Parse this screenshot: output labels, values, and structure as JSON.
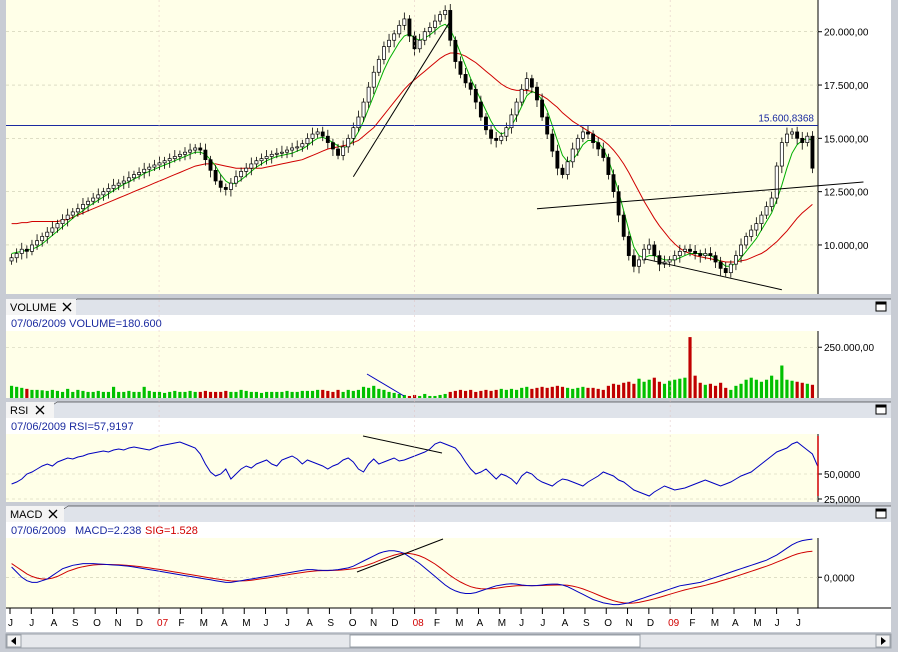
{
  "colors": {
    "bg": "#ffffe8",
    "frame": "#c8ccd4",
    "up": "#ffffff",
    "down": "#000000",
    "sma_fast": "#00b000",
    "sma_slow": "#d00000",
    "trend": "#0000c0",
    "vol_up": "#00c000",
    "vol_down": "#c00000",
    "rsi": "#0000c0",
    "macd": "#0000c0",
    "sig": "#d00000"
  },
  "icons": {
    "panel_close": "close-icon",
    "panel_max": "maximize-icon",
    "scroll_left": "arrow-left-icon",
    "scroll_right": "arrow-right-icon"
  },
  "chart_data": [
    {
      "type": "candlestick",
      "title": "",
      "y_ticks": [
        "20.000,00",
        "17.500,00",
        "15.000,00",
        "12.500,00",
        "10.000,00"
      ],
      "ylim": [
        7700,
        21300
      ],
      "hline_label": "15.600,8368",
      "hline_value": 15600.8368,
      "closes": [
        9400,
        9600,
        9800,
        9700,
        10000,
        10200,
        10400,
        10600,
        10800,
        11000,
        11200,
        11400,
        11550,
        11700,
        11900,
        12050,
        12200,
        12350,
        12500,
        12650,
        12800,
        12900,
        13000,
        13150,
        13300,
        13400,
        13550,
        13650,
        13750,
        13850,
        13950,
        14050,
        14150,
        14250,
        14350,
        14450,
        14550,
        14450,
        14000,
        13500,
        13000,
        12700,
        12600,
        12900,
        13200,
        13450,
        13600,
        13800,
        13950,
        14050,
        14150,
        14250,
        14300,
        14350,
        14450,
        14550,
        14600,
        14750,
        15000,
        15200,
        15300,
        15100,
        14800,
        14500,
        14200,
        14600,
        15000,
        15500,
        16000,
        16700,
        17400,
        18100,
        18700,
        19300,
        19600,
        19900,
        20300,
        20600,
        19800,
        19200,
        19600,
        20000,
        20200,
        20500,
        20800,
        21000,
        19600,
        18600,
        18000,
        17600,
        17300,
        16700,
        16000,
        15400,
        15000,
        14900,
        15100,
        15500,
        16100,
        16700,
        17300,
        17800,
        17400,
        16800,
        16000,
        15200,
        14400,
        13600,
        13300,
        13900,
        14500,
        15000,
        15300,
        15200,
        14800,
        14500,
        14100,
        13300,
        12500,
        11400,
        10400,
        9500,
        9000,
        9300,
        9800,
        10000,
        9500,
        9100,
        9200,
        9300,
        9500,
        9700,
        9800,
        9700,
        9600,
        9500,
        9600,
        9500,
        9200,
        8900,
        8700,
        9100,
        9500,
        10000,
        10400,
        10700,
        11000,
        11400,
        11800,
        12200,
        13700,
        14800,
        15200,
        15300,
        15000,
        14800,
        15100,
        13600
      ],
      "sma_fast": [
        9600,
        9650,
        9700,
        9750,
        9800,
        9900,
        10050,
        10250,
        10450,
        10650,
        10850,
        11050,
        11250,
        11450,
        11600,
        11800,
        11950,
        12100,
        12250,
        12400,
        12550,
        12700,
        12850,
        12950,
        13100,
        13200,
        13350,
        13450,
        13550,
        13650,
        13750,
        13850,
        13950,
        14050,
        14150,
        14250,
        14350,
        14350,
        14250,
        14000,
        13700,
        13300,
        13000,
        12850,
        12900,
        13050,
        13250,
        13450,
        13650,
        13800,
        13950,
        14050,
        14150,
        14200,
        14250,
        14300,
        14400,
        14500,
        14650,
        14850,
        15000,
        15050,
        14950,
        14800,
        14650,
        14550,
        14650,
        14900,
        15300,
        15800,
        16400,
        17000,
        17600,
        18200,
        18700,
        19100,
        19500,
        19800,
        19900,
        19700,
        19600,
        19700,
        19850,
        20050,
        20250,
        20350,
        20100,
        19600,
        19000,
        18400,
        17800,
        17300,
        16800,
        16300,
        15800,
        15400,
        15200,
        15300,
        15600,
        16000,
        16500,
        17000,
        17200,
        17100,
        16800,
        16300,
        15600,
        14900,
        14200,
        13900,
        14000,
        14300,
        14700,
        14900,
        14900,
        14800,
        14500,
        14000,
        13300,
        12500,
        11600,
        10700,
        9900,
        9500,
        9400,
        9500,
        9500,
        9400,
        9300,
        9300,
        9300,
        9400,
        9500,
        9600,
        9600,
        9600,
        9550,
        9500,
        9400,
        9200,
        9000,
        9000,
        9150,
        9400,
        9700,
        10000,
        10300,
        10700,
        11100,
        11500,
        12100,
        12800,
        13600,
        14300,
        14700,
        14900,
        15000,
        14900
      ],
      "sma_slow": [
        11000,
        11000,
        11050,
        11050,
        11100,
        11100,
        11100,
        11100,
        11100,
        11100,
        11150,
        11200,
        11300,
        11400,
        11500,
        11600,
        11700,
        11800,
        11900,
        12000,
        12100,
        12200,
        12300,
        12400,
        12500,
        12600,
        12700,
        12800,
        12900,
        13000,
        13100,
        13200,
        13300,
        13400,
        13500,
        13600,
        13700,
        13750,
        13800,
        13800,
        13800,
        13750,
        13700,
        13650,
        13600,
        13600,
        13600,
        13600,
        13600,
        13600,
        13650,
        13700,
        13750,
        13800,
        13850,
        13900,
        13950,
        14000,
        14100,
        14200,
        14300,
        14400,
        14500,
        14550,
        14600,
        14650,
        14700,
        14800,
        14900,
        15100,
        15300,
        15500,
        15800,
        16100,
        16400,
        16700,
        17000,
        17300,
        17550,
        17750,
        17950,
        18150,
        18350,
        18550,
        18750,
        18900,
        19000,
        19000,
        18950,
        18850,
        18700,
        18550,
        18350,
        18150,
        17950,
        17750,
        17550,
        17400,
        17300,
        17250,
        17250,
        17250,
        17200,
        17100,
        17000,
        16850,
        16650,
        16450,
        16200,
        16000,
        15800,
        15650,
        15500,
        15350,
        15200,
        15050,
        14900,
        14700,
        14450,
        14150,
        13800,
        13400,
        12950,
        12500,
        12050,
        11650,
        11250,
        10900,
        10600,
        10300,
        10050,
        9850,
        9700,
        9600,
        9500,
        9450,
        9400,
        9350,
        9300,
        9250,
        9200,
        9200,
        9200,
        9250,
        9300,
        9400,
        9500,
        9600,
        9750,
        9950,
        10150,
        10400,
        10650,
        10950,
        11250,
        11500,
        11700,
        11900
      ],
      "trendlines": [
        {
          "from": [
            67,
            13200
          ],
          "to": [
            86,
            20500
          ]
        },
        {
          "from": [
            103,
            11700
          ],
          "to": [
            167,
            12950
          ]
        },
        {
          "from": [
            124,
            9350
          ],
          "to": [
            151,
            7900
          ]
        }
      ]
    },
    {
      "type": "bar",
      "panel_title": "VOLUME",
      "info": "07/06/2009 VOLUME=180.600",
      "y_ticks": [
        "250.000,00"
      ],
      "ylim": [
        0,
        330000
      ],
      "up_down": "derived from candle direction",
      "values": [
        60000,
        55000,
        50000,
        45000,
        40000,
        40000,
        38000,
        35000,
        40000,
        35000,
        30000,
        45000,
        30000,
        40000,
        35000,
        30000,
        30000,
        35000,
        30000,
        30000,
        55000,
        30000,
        30000,
        35000,
        30000,
        30000,
        55000,
        35000,
        30000,
        30000,
        25000,
        30000,
        35000,
        30000,
        30000,
        35000,
        30000,
        30000,
        35000,
        30000,
        30000,
        30000,
        35000,
        30000,
        30000,
        40000,
        35000,
        30000,
        30000,
        25000,
        30000,
        30000,
        30000,
        30000,
        35000,
        30000,
        30000,
        35000,
        35000,
        35000,
        40000,
        40000,
        35000,
        30000,
        40000,
        30000,
        40000,
        35000,
        40000,
        55000,
        50000,
        60000,
        45000,
        40000,
        30000,
        25000,
        20000,
        15000,
        10000,
        15000,
        10000,
        20000,
        10000,
        10000,
        15000,
        20000,
        30000,
        35000,
        40000,
        35000,
        40000,
        30000,
        35000,
        40000,
        35000,
        40000,
        45000,
        40000,
        45000,
        40000,
        50000,
        55000,
        45000,
        50000,
        55000,
        50000,
        55000,
        60000,
        55000,
        50000,
        45000,
        50000,
        55000,
        50000,
        50000,
        45000,
        40000,
        60000,
        70000,
        65000,
        75000,
        80000,
        70000,
        95000,
        80000,
        90000,
        100000,
        80000,
        70000,
        85000,
        90000,
        95000,
        100000,
        300000,
        110000,
        75000,
        65000,
        70000,
        60000,
        75000,
        50000,
        40000,
        60000,
        70000,
        90000,
        100000,
        90000,
        80000,
        90000,
        110000,
        90000,
        160000,
        90000,
        85000,
        80000,
        75000,
        70000,
        65000
      ]
    },
    {
      "type": "line",
      "panel_title": "RSI",
      "info": "07/06/2009 RSI=57,9197",
      "y_ticks": [
        "50,0000",
        "25,0000"
      ],
      "ylim": [
        22,
        90
      ],
      "values": [
        40,
        42,
        45,
        50,
        52,
        55,
        58,
        60,
        58,
        62,
        64,
        66,
        65,
        67,
        68,
        70,
        71,
        72,
        73,
        72,
        74,
        75,
        74,
        76,
        77,
        76,
        75,
        74,
        76,
        78,
        79,
        80,
        81,
        82,
        80,
        78,
        76,
        70,
        60,
        52,
        48,
        50,
        55,
        45,
        50,
        55,
        58,
        56,
        60,
        62,
        64,
        60,
        58,
        64,
        66,
        68,
        65,
        60,
        64,
        62,
        60,
        58,
        55,
        58,
        60,
        64,
        66,
        62,
        55,
        52,
        60,
        65,
        60,
        62,
        64,
        66,
        63,
        64,
        66,
        68,
        70,
        72,
        75,
        80,
        82,
        80,
        78,
        76,
        70,
        62,
        55,
        50,
        52,
        55,
        50,
        45,
        50,
        48,
        45,
        40,
        48,
        52,
        50,
        45,
        42,
        40,
        38,
        42,
        45,
        44,
        42,
        40,
        38,
        42,
        45,
        48,
        52,
        50,
        48,
        44,
        42,
        38,
        34,
        32,
        30,
        28,
        32,
        35,
        38,
        36,
        34,
        35,
        36,
        38,
        40,
        42,
        44,
        42,
        40,
        38,
        40,
        42,
        45,
        48,
        50,
        52,
        56,
        60,
        64,
        68,
        72,
        74,
        76,
        80,
        82,
        78,
        74,
        70,
        58
      ]
    },
    {
      "type": "line",
      "panel_title": "MACD",
      "info_date": "07/06/2009",
      "macd_label": "MACD=2.238",
      "sig_label": "SIG=1.528",
      "y_ticks": [
        "0,0000"
      ],
      "ylim": [
        -1.8,
        2.3
      ],
      "macd": [
        0.6,
        0.3,
        0.0,
        -0.2,
        -0.3,
        -0.3,
        -0.2,
        -0.1,
        0.1,
        0.3,
        0.5,
        0.6,
        0.7,
        0.75,
        0.8,
        0.8,
        0.8,
        0.78,
        0.76,
        0.74,
        0.72,
        0.7,
        0.68,
        0.65,
        0.6,
        0.55,
        0.5,
        0.45,
        0.4,
        0.35,
        0.3,
        0.25,
        0.2,
        0.15,
        0.1,
        0.05,
        0.0,
        -0.05,
        -0.1,
        -0.15,
        -0.2,
        -0.25,
        -0.3,
        -0.3,
        -0.25,
        -0.2,
        -0.15,
        -0.1,
        -0.05,
        0.0,
        0.05,
        0.1,
        0.15,
        0.2,
        0.25,
        0.3,
        0.35,
        0.4,
        0.45,
        0.45,
        0.42,
        0.4,
        0.4,
        0.42,
        0.45,
        0.5,
        0.55,
        0.65,
        0.8,
        0.95,
        1.1,
        1.25,
        1.4,
        1.5,
        1.55,
        1.55,
        1.5,
        1.4,
        1.2,
        1.0,
        0.8,
        0.55,
        0.3,
        0.05,
        -0.2,
        -0.45,
        -0.65,
        -0.8,
        -0.9,
        -0.95,
        -0.95,
        -0.9,
        -0.8,
        -0.7,
        -0.6,
        -0.5,
        -0.45,
        -0.4,
        -0.38,
        -0.4,
        -0.45,
        -0.48,
        -0.5,
        -0.48,
        -0.45,
        -0.42,
        -0.4,
        -0.4,
        -0.45,
        -0.55,
        -0.7,
        -0.85,
        -1.0,
        -1.15,
        -1.3,
        -1.4,
        -1.5,
        -1.55,
        -1.6,
        -1.6,
        -1.55,
        -1.5,
        -1.4,
        -1.3,
        -1.2,
        -1.1,
        -1.0,
        -0.9,
        -0.8,
        -0.7,
        -0.6,
        -0.5,
        -0.45,
        -0.4,
        -0.35,
        -0.3,
        -0.2,
        -0.1,
        0.0,
        0.1,
        0.2,
        0.3,
        0.4,
        0.5,
        0.6,
        0.7,
        0.8,
        0.9,
        1.0,
        1.15,
        1.3,
        1.5,
        1.7,
        1.9,
        2.05,
        2.15,
        2.2,
        2.238
      ],
      "sig": [
        0.8,
        0.6,
        0.4,
        0.2,
        0.05,
        -0.05,
        -0.1,
        -0.1,
        -0.05,
        0.05,
        0.2,
        0.35,
        0.45,
        0.55,
        0.62,
        0.68,
        0.72,
        0.74,
        0.75,
        0.75,
        0.74,
        0.73,
        0.71,
        0.69,
        0.66,
        0.63,
        0.59,
        0.55,
        0.5,
        0.46,
        0.41,
        0.36,
        0.31,
        0.26,
        0.21,
        0.16,
        0.11,
        0.06,
        0.01,
        -0.04,
        -0.09,
        -0.13,
        -0.18,
        -0.21,
        -0.22,
        -0.21,
        -0.2,
        -0.17,
        -0.13,
        -0.09,
        -0.05,
        0.0,
        0.05,
        0.1,
        0.14,
        0.19,
        0.24,
        0.28,
        0.32,
        0.35,
        0.38,
        0.39,
        0.39,
        0.4,
        0.41,
        0.43,
        0.46,
        0.5,
        0.56,
        0.64,
        0.74,
        0.85,
        0.97,
        1.09,
        1.2,
        1.3,
        1.37,
        1.41,
        1.39,
        1.34,
        1.25,
        1.12,
        0.96,
        0.78,
        0.56,
        0.33,
        0.1,
        -0.1,
        -0.28,
        -0.43,
        -0.55,
        -0.63,
        -0.67,
        -0.68,
        -0.67,
        -0.64,
        -0.6,
        -0.56,
        -0.53,
        -0.5,
        -0.49,
        -0.49,
        -0.49,
        -0.49,
        -0.48,
        -0.47,
        -0.46,
        -0.45,
        -0.45,
        -0.47,
        -0.52,
        -0.59,
        -0.68,
        -0.79,
        -0.91,
        -1.04,
        -1.16,
        -1.27,
        -1.37,
        -1.45,
        -1.5,
        -1.52,
        -1.51,
        -1.47,
        -1.41,
        -1.34,
        -1.26,
        -1.18,
        -1.09,
        -1.0,
        -0.91,
        -0.82,
        -0.74,
        -0.67,
        -0.6,
        -0.54,
        -0.47,
        -0.39,
        -0.31,
        -0.22,
        -0.13,
        -0.04,
        0.05,
        0.15,
        0.25,
        0.35,
        0.45,
        0.55,
        0.65,
        0.76,
        0.88,
        1.0,
        1.13,
        1.26,
        1.36,
        1.44,
        1.5,
        1.528
      ]
    }
  ],
  "x_months": [
    "J",
    "J",
    "A",
    "S",
    "O",
    "N",
    "D",
    "07",
    "F",
    "M",
    "A",
    "M",
    "J",
    "J",
    "A",
    "S",
    "O",
    "N",
    "D",
    "08",
    "F",
    "M",
    "A",
    "M",
    "J",
    "J",
    "A",
    "S",
    "O",
    "N",
    "D",
    "09",
    "F",
    "M",
    "A",
    "M",
    "J",
    "J"
  ],
  "x_year_labels": [
    "07",
    "08",
    "09"
  ]
}
